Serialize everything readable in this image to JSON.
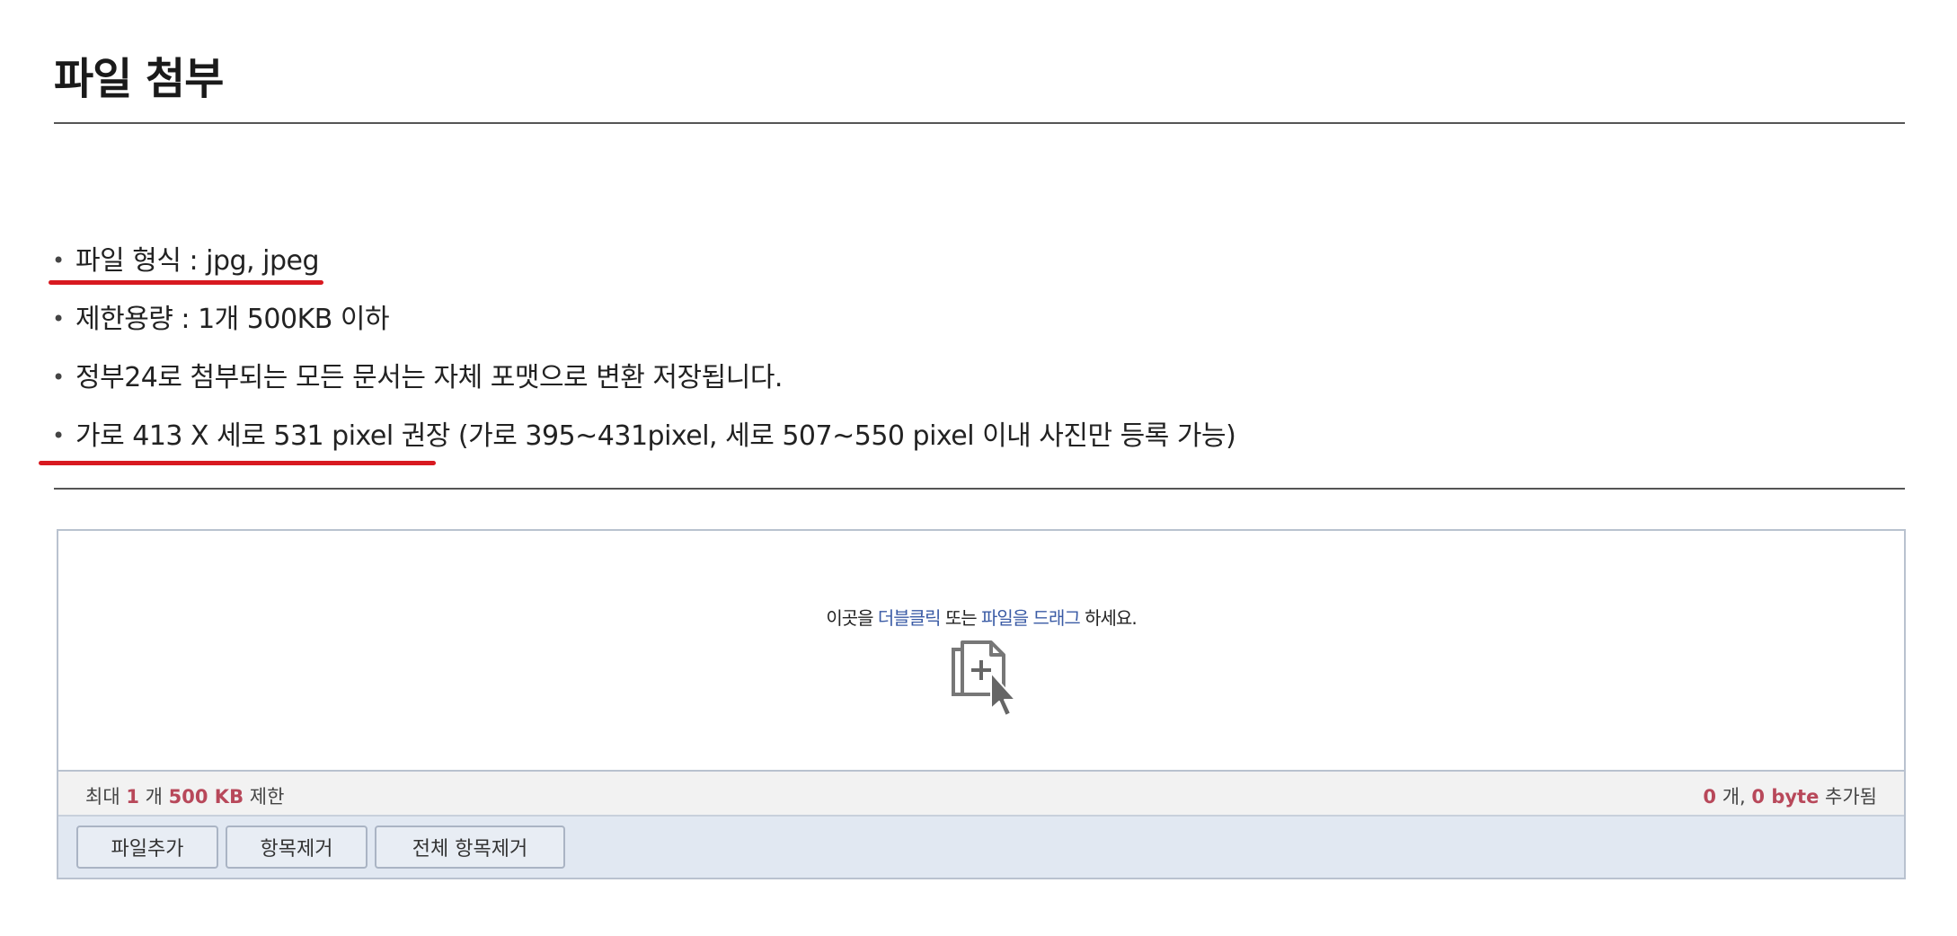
{
  "title": "파일 첨부",
  "notes": [
    "파일 형식 : jpg, jpeg",
    "제한용량 : 1개 500KB 이하",
    "정부24로 첨부되는 모든 문서는 자체 포맷으로 변환 저장됩니다.",
    "가로 413 X 세로 531 pixel 권장 (가로 395~431pixel, 세로 507~550 pixel 이내 사진만 등록 가능)"
  ],
  "bullet": "•",
  "underline_color": "#d81920",
  "dropzone": {
    "prefix": "이곳을 ",
    "double_click": "더블클릭",
    "middle": " 또는 ",
    "drag": "파일을 드래그",
    "suffix": " 하세요.",
    "icon": "file-add-cursor-icon"
  },
  "status": {
    "max_label": "최대",
    "max_count": "1",
    "count_unit": "개",
    "max_size": "500 KB",
    "limit_label": "제한",
    "added_count": "0",
    "added_count_unit": "개,",
    "added_bytes": "0 byte",
    "added_label": "추가됨"
  },
  "buttons": {
    "add": "파일추가",
    "remove": "항목제거",
    "remove_all": "전체 항목제거"
  },
  "colors": {
    "highlight_blue": "#3a5ba5",
    "emphasis_red": "#b8485a",
    "button_bar_bg": "#e1e8f2"
  }
}
